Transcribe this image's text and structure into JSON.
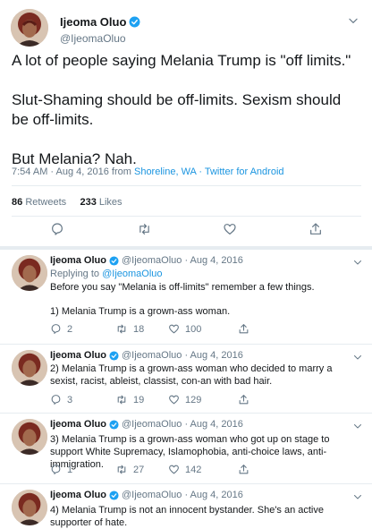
{
  "main_tweet": {
    "author_name": "Ijeoma Oluo",
    "author_handle": "@IjeomaOluo",
    "text": [
      "A lot of people saying Melania Trump is \"off limits.\"",
      "Slut-Shaming should be off-limits. Sexism should be off-limits.",
      "But Melania? Nah."
    ],
    "timestamp": "7:54 AM · Aug 4, 2016 from",
    "location": "Shoreline, WA",
    "client": "· Twitter for Android",
    "retweets_count": "86",
    "retweets_label": "Retweets",
    "likes_count": "233",
    "likes_label": "Likes"
  },
  "replies": [
    {
      "name": "Ijeoma Oluo",
      "handle_date": "@IjeomaOluo · Aug 4, 2016",
      "replying_prefix": "Replying to",
      "replying_handle": "@IjeomaOluo",
      "text": [
        "Before you say \"Melania is off-limits\"  remember a few things.",
        "1) Melania Trump is a grown-ass woman."
      ],
      "replies": "2",
      "retweets": "18",
      "likes": "100"
    },
    {
      "name": "Ijeoma Oluo",
      "handle_date": "@IjeomaOluo · Aug 4, 2016",
      "text": [
        "2) Melania Trump is a grown-ass woman who decided to marry a sexist, racist, ableist, classist, con-an with bad hair."
      ],
      "replies": "3",
      "retweets": "19",
      "likes": "129"
    },
    {
      "name": "Ijeoma Oluo",
      "handle_date": "@IjeomaOluo · Aug 4, 2016",
      "text": [
        "3) Melania Trump is a grown-ass woman who got up on stage to support White Supremacy, Islamophobia, anti-choice laws, anti-immigration."
      ],
      "replies": "1",
      "retweets": "27",
      "likes": "142"
    },
    {
      "name": "Ijeoma Oluo",
      "handle_date": "@IjeomaOluo · Aug 4, 2016",
      "text": [
        "4) Melania Trump is not an innocent bystander. She's an active supporter of hate."
      ]
    }
  ],
  "colors": {
    "accent": "#1b95e0",
    "verified": "#1da1f2",
    "muted": "#657786",
    "divider": "#e6ecf0"
  },
  "icons": [
    "verified-badge-icon",
    "chevron-down-icon",
    "reply-icon",
    "retweet-icon",
    "like-icon",
    "share-icon"
  ]
}
